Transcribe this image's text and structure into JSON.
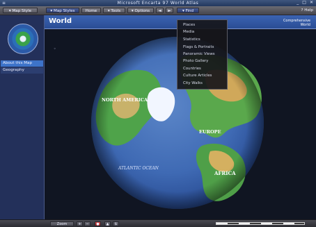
{
  "window": {
    "title": "Microsoft Encarta 97 World Atlas",
    "controls": [
      "_",
      "□",
      "✕"
    ]
  },
  "menubar": {
    "items": [
      {
        "label": "Map Style",
        "arrow": "▾"
      },
      {
        "label": "Map Styles",
        "arrow": "▾"
      },
      {
        "label": "Home",
        "arrow": ""
      },
      {
        "label": "Tools",
        "arrow": "▾"
      },
      {
        "label": "Options",
        "arrow": "▾"
      },
      {
        "label": "◄",
        "arrow": ""
      },
      {
        "label": "►",
        "arrow": ""
      },
      {
        "label": "Find",
        "arrow": "▾"
      }
    ],
    "help_label": "Help"
  },
  "sidebar": {
    "items": [
      {
        "label": "About this Map",
        "selected": true
      },
      {
        "label": "Geography",
        "selected": false
      }
    ]
  },
  "header": {
    "title": "World",
    "mode_line1": "Comprehensive",
    "mode_line2": "World"
  },
  "map": {
    "labels": {
      "north_america": "NORTH AMERICA",
      "europe": "EUROPE",
      "atlantic_ocean": "ATLANTIC OCEAN",
      "africa": "AFRICA"
    },
    "colors": {
      "ocean": "#2a5ca8",
      "land": "#4aa04a",
      "ice": "#f2f6ff"
    }
  },
  "find_menu": {
    "items": [
      "Places",
      "Media",
      "Statistics",
      "Flags & Portraits",
      "Panoramic Views",
      "Photo Gallery",
      "Countries",
      "Culture Articles",
      "City Walks"
    ]
  },
  "statusbar": {
    "zoom_label": "Zoom",
    "buttons": [
      "+",
      "−",
      "●",
      "▲",
      "$"
    ]
  }
}
